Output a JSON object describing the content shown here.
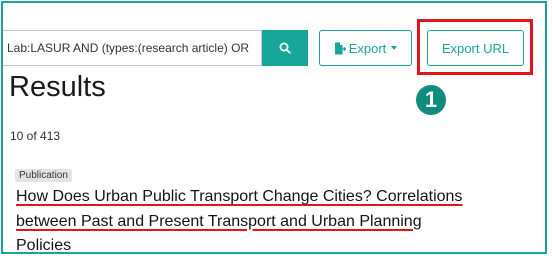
{
  "search": {
    "value": "Lab:LASUR AND (types:(research article) OR"
  },
  "toolbar": {
    "export_label": "Export",
    "export_url_label": "Export URL"
  },
  "annotation": {
    "step_number": "1",
    "highlight_color": "#e3141b",
    "step_color": "#0f8c7d"
  },
  "accent_color": "#18a59a",
  "results": {
    "heading": "Results",
    "count": "10 of 413",
    "items": [
      {
        "type": "Publication",
        "title_lines": [
          "How Does Urban Public Transport Change Cities? Correlations",
          "between Past and Present Transport and Urban Planning",
          "Policies"
        ]
      }
    ]
  },
  "icons": {
    "search": "search-icon",
    "export": "file-export-icon"
  }
}
